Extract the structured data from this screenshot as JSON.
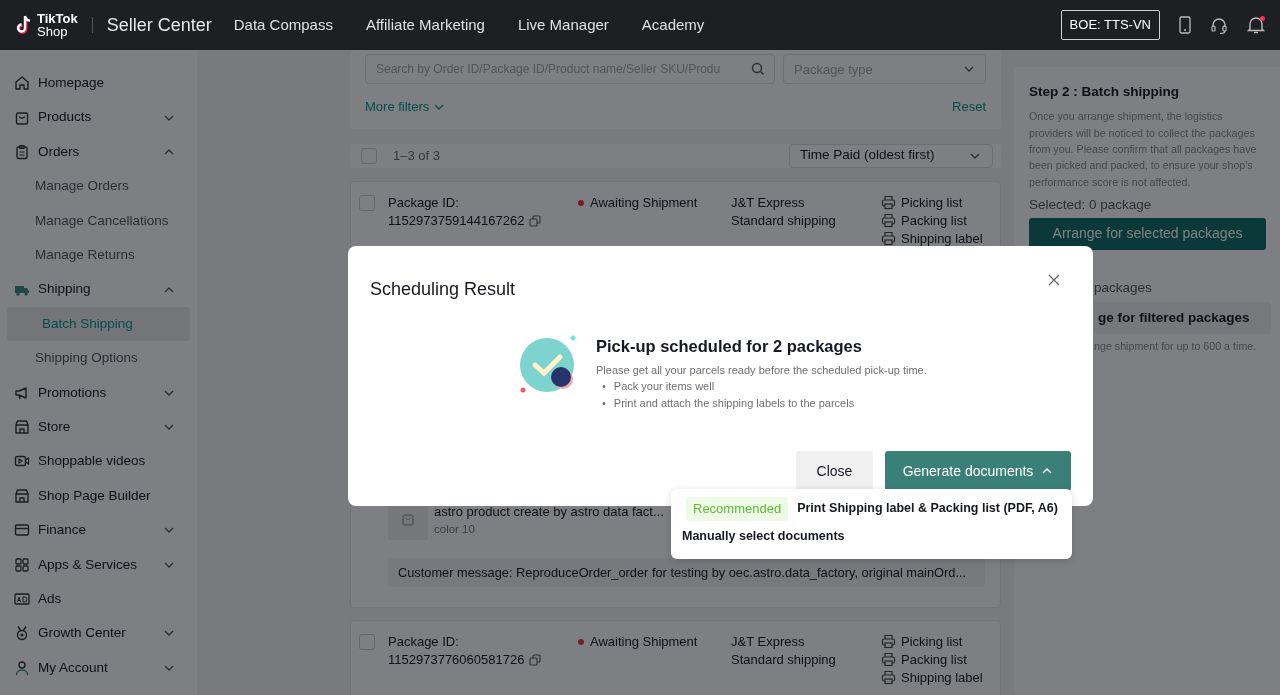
{
  "topbar": {
    "logo_title": "TikTok",
    "logo_subtitle": "Shop",
    "product": "Seller Center",
    "nav": [
      {
        "label": "Data Compass"
      },
      {
        "label": "Affiliate Marketing"
      },
      {
        "label": "Live Manager"
      },
      {
        "label": "Academy"
      }
    ],
    "account": "BOE: TTS-VN",
    "has_notification": true
  },
  "sidebar": {
    "items": [
      {
        "label": "Homepage",
        "selected": false
      },
      {
        "label": "Products",
        "selected": false,
        "expanded": false
      },
      {
        "label": "Orders",
        "selected": false,
        "expanded": true,
        "children": [
          {
            "label": "Manage Orders",
            "selected": false
          },
          {
            "label": "Manage Cancellations",
            "selected": false
          },
          {
            "label": "Manage Returns",
            "selected": false
          }
        ]
      },
      {
        "label": "Shipping",
        "selected": false,
        "expanded": true,
        "children": [
          {
            "label": "Batch Shipping",
            "selected": true
          },
          {
            "label": "Shipping Options",
            "selected": false
          }
        ]
      },
      {
        "label": "Promotions",
        "selected": false,
        "expanded": false
      },
      {
        "label": "Store",
        "selected": false,
        "expanded": false
      },
      {
        "label": "Shoppable videos",
        "selected": false
      },
      {
        "label": "Shop Page Builder",
        "selected": false
      },
      {
        "label": "Finance",
        "selected": false,
        "expanded": false
      },
      {
        "label": "Apps & Services",
        "selected": false,
        "expanded": false
      },
      {
        "label": "Ads",
        "selected": false
      },
      {
        "label": "Growth Center",
        "selected": false,
        "expanded": false
      },
      {
        "label": "My Account",
        "selected": false,
        "expanded": false
      }
    ]
  },
  "filters": {
    "search_placeholder": "Search by Order ID/Package ID/Product name/Seller SKU/Produ",
    "package_type_placeholder": "Package type",
    "more_filters": "More filters",
    "reset": "Reset"
  },
  "list_header": {
    "checked": false,
    "count": "1–3 of 3",
    "sort": "Time Paid (oldest first)"
  },
  "packages": [
    {
      "checked": false,
      "id_label": "Package ID:",
      "id": "1152973759144167262",
      "status": "Awaiting Shipment",
      "carrier": "J&T Express",
      "service": "Standard shipping",
      "documents": [
        "Picking list",
        "Packing list",
        "Shipping label"
      ],
      "product": {
        "name": "astro product create by astro data fact...",
        "variant": "color 10"
      },
      "customer_message": "Customer message: ReproduceOrder_order for testing by oec.astro.data_factory, original mainOrd..."
    },
    {
      "checked": false,
      "id_label": "Package ID:",
      "id": "1152973776060581726",
      "status": "Awaiting Shipment",
      "carrier": "J&T Express",
      "service": "Standard shipping",
      "documents": [
        "Picking list",
        "Packing list",
        "Shipping label"
      ]
    }
  ],
  "side_panel": {
    "title": "Step 2 : Batch shipping",
    "description": "Once you arrange shipment, the logistics providers will be noticed to collect the packages from you. Please confirm that all packages have been picked and packed, to ensure your shop's performance score is not affected.",
    "selected_count": "Selected: 0 package",
    "arrange_selected": "Arrange for selected packages",
    "filtered_label": "packages",
    "arrange_filtered": "ge for filtered packages",
    "filtered_note": "nge shipment for up to 600 a time."
  },
  "modal": {
    "title": "Scheduling Result",
    "heading": "Pick-up scheduled for 2 packages",
    "message": "Please get all your parcels ready before the scheduled pick-up time.",
    "bullet": "•",
    "tips": [
      "Pack your items well",
      "Print and attach the shipping labels to the parcels"
    ],
    "buttons": [
      {
        "label": "Close",
        "kind": "secondary"
      },
      {
        "label": "Generate documents",
        "kind": "primary",
        "expanded": true
      }
    ],
    "menu": [
      {
        "tag": "Recommended",
        "label": "Print Shipping label & Packing list (PDF, A6)"
      },
      {
        "label": "Manually select documents"
      }
    ]
  }
}
